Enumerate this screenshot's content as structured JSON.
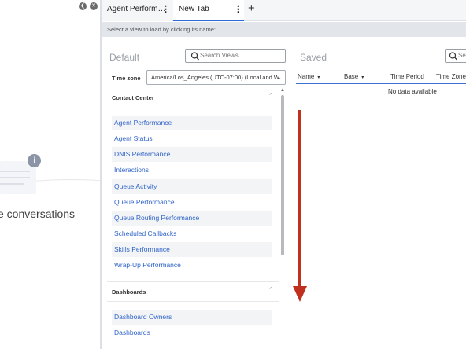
{
  "left_pane": {
    "empty_state_text": "e conversations",
    "collapse_icon": "chevron-left-icon",
    "close_icon": "close-icon",
    "info_icon": "info-icon"
  },
  "tabs": [
    {
      "label": "Agent Perform…",
      "menu": "⋮"
    },
    {
      "label": "New Tab",
      "menu": "⋮"
    }
  ],
  "add_tab_label": "+",
  "hint": "Select a view to load by clicking its name:",
  "default_panel": {
    "title": "Default",
    "search_placeholder": "Search Views",
    "timezone_label": "Time zone",
    "timezone_value": "America/Los_Angeles (UTC-07:00) (Local and W…",
    "sections": [
      {
        "title": "Contact Center",
        "items": [
          "Agent Performance",
          "Agent Status",
          "DNIS Performance",
          "Interactions",
          "Queue Activity",
          "Queue Performance",
          "Queue Routing Performance",
          "Scheduled Callbacks",
          "Skills Performance",
          "Wrap-Up Performance"
        ]
      },
      {
        "title": "Dashboards",
        "items": [
          "Dashboard Owners",
          "Dashboards"
        ]
      }
    ]
  },
  "saved_panel": {
    "title": "Saved",
    "search_placeholder": "Sea",
    "columns": [
      "Name",
      "Base",
      "Time Period",
      "Time Zone"
    ],
    "sort_marker": "▾",
    "empty_text": "No data available"
  },
  "colors": {
    "link": "#2f63c8",
    "active_tab_underline": "#2a6ad9",
    "annotation_arrow": "#c0301e"
  }
}
